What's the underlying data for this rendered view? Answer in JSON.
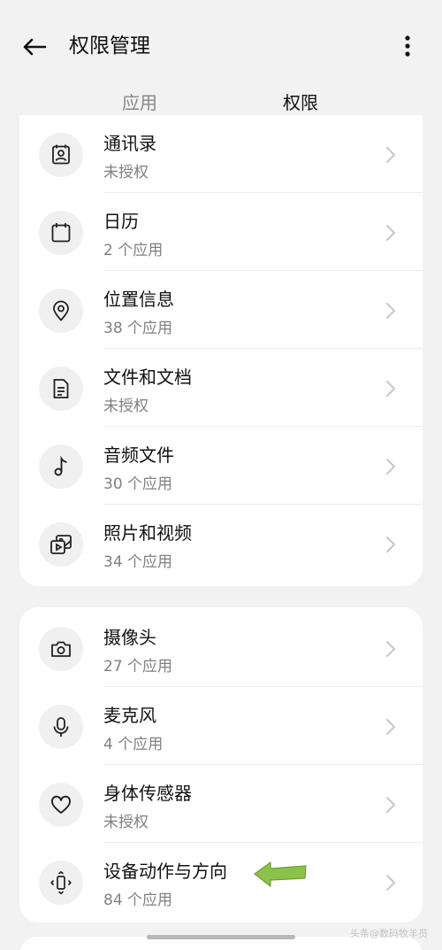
{
  "header": {
    "title": "权限管理",
    "back_icon": "back-arrow-icon",
    "more_icon": "more-vertical-icon"
  },
  "tabs": [
    {
      "label": "应用",
      "active": false
    },
    {
      "label": "权限",
      "active": true
    }
  ],
  "group1": [
    {
      "label": "通讯录",
      "sub": "未授权",
      "icon": "contacts-icon"
    },
    {
      "label": "日历",
      "sub": "2 个应用",
      "icon": "calendar-icon"
    },
    {
      "label": "位置信息",
      "sub": "38 个应用",
      "icon": "location-pin-icon"
    },
    {
      "label": "文件和文档",
      "sub": "未授权",
      "icon": "document-icon"
    },
    {
      "label": "音频文件",
      "sub": "30 个应用",
      "icon": "music-note-icon"
    },
    {
      "label": "照片和视频",
      "sub": "34 个应用",
      "icon": "photo-video-icon"
    }
  ],
  "group2": [
    {
      "label": "摄像头",
      "sub": "27 个应用",
      "icon": "camera-icon"
    },
    {
      "label": "麦克风",
      "sub": "4 个应用",
      "icon": "microphone-icon"
    },
    {
      "label": "身体传感器",
      "sub": "未授权",
      "icon": "heart-icon"
    },
    {
      "label": "设备动作与方向",
      "sub": "84 个应用",
      "icon": "device-motion-icon"
    }
  ],
  "watermark": "头条@数码牧羊员",
  "colors": {
    "background": "#f2f2f2",
    "card": "#ffffff",
    "icon_bg": "#f0f0f0",
    "secondary_text": "#808080",
    "annotation_arrow": "#8bc34a"
  }
}
